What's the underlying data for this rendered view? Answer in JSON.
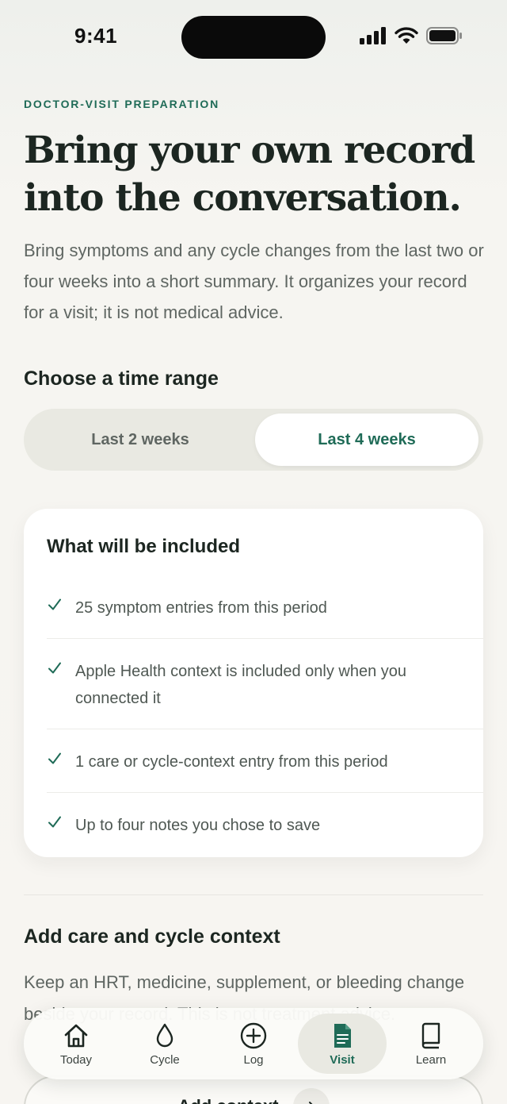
{
  "status_bar": {
    "time": "9:41"
  },
  "header": {
    "eyebrow": "DOCTOR-VISIT PREPARATION",
    "title": "Bring your own record into the conversation.",
    "intro": "Bring symptoms and any cycle changes from the last two or four weeks into a short summary. It organizes your record for a visit; it is not medical advice."
  },
  "time_range": {
    "title": "Choose a time range",
    "options": [
      {
        "label": "Last 2 weeks",
        "selected": false
      },
      {
        "label": "Last 4 weeks",
        "selected": true
      }
    ]
  },
  "included": {
    "title": "What will be included",
    "items": [
      "25 symptom entries from this period",
      "Apple Health context is included only when you connected it",
      "1 care or cycle-context entry from this period",
      "Up to four notes you chose to save"
    ]
  },
  "care_context": {
    "title": "Add care and cycle context",
    "text": "Keep an HRT, medicine, supplement, or bleeding change beside your record. This is not treatment advice.",
    "button_label": "Add context"
  },
  "tab_bar": {
    "tabs": [
      {
        "label": "Today",
        "icon": "home-icon",
        "active": false
      },
      {
        "label": "Cycle",
        "icon": "drop-icon",
        "active": false
      },
      {
        "label": "Log",
        "icon": "plus-circle-icon",
        "active": false
      },
      {
        "label": "Visit",
        "icon": "document-icon",
        "active": true
      },
      {
        "label": "Learn",
        "icon": "book-icon",
        "active": false
      }
    ]
  },
  "colors": {
    "accent": "#1f6b57",
    "text": "#1c2621",
    "muted": "#5f6662"
  }
}
